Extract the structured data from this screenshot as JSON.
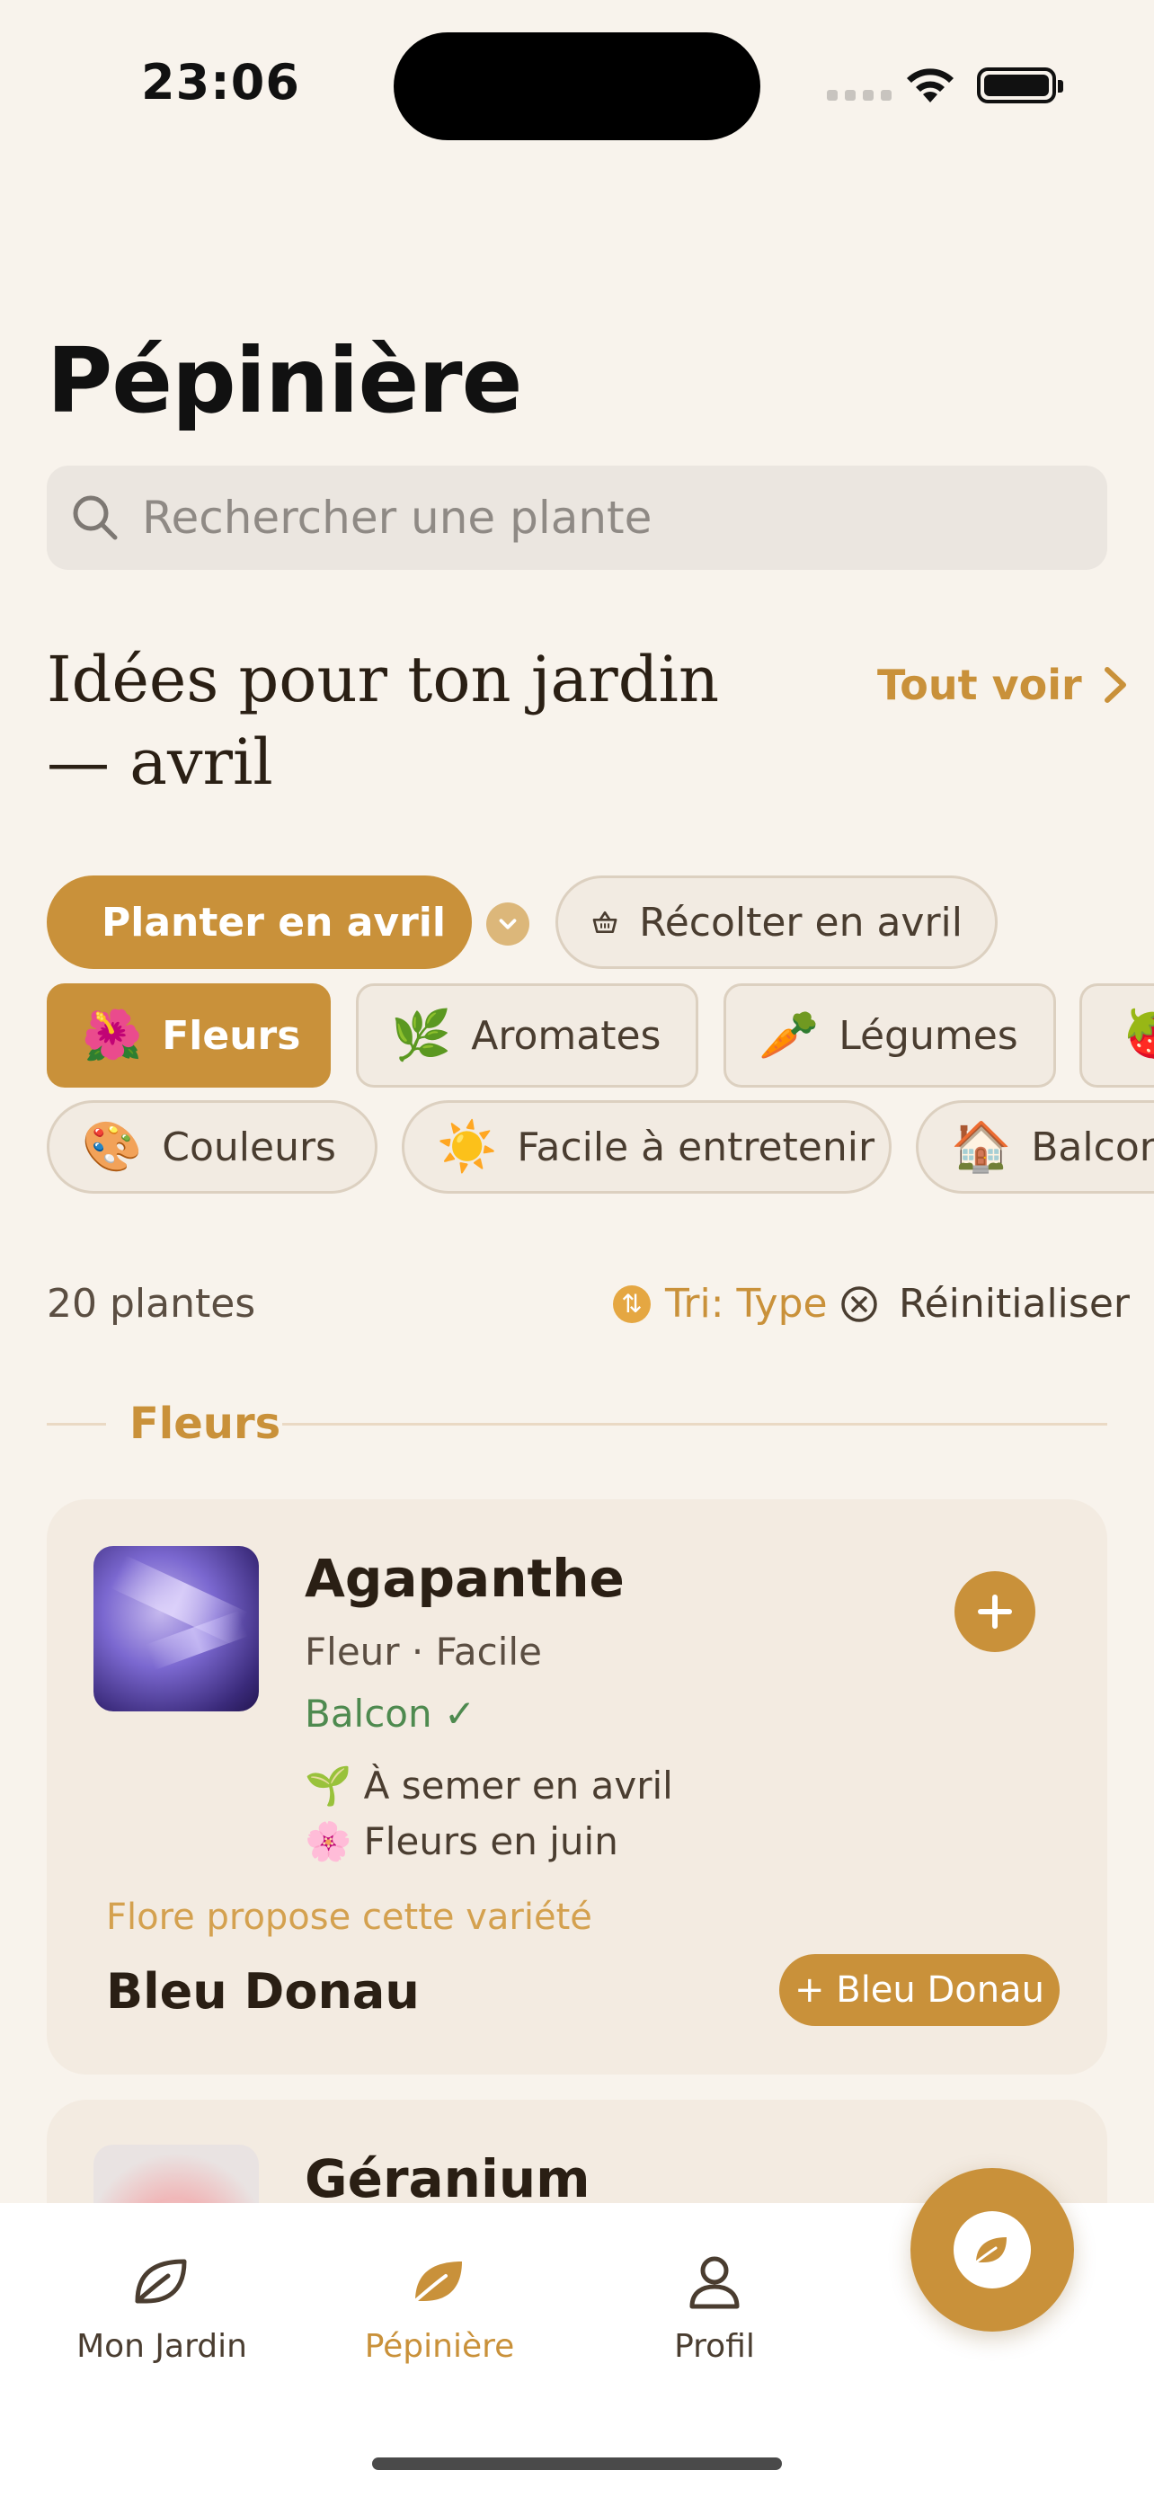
{
  "status": {
    "time": "23:06"
  },
  "page": {
    "title": "Pépinière"
  },
  "search": {
    "placeholder": "Rechercher une plante"
  },
  "ideas": {
    "title": "Idées pour ton jardin — avril",
    "see_all": "Tout voir"
  },
  "action_chips": [
    {
      "label": "Planter en avril",
      "icon": "leaf-icon",
      "active": true
    },
    {
      "label": "Récolter en avril",
      "icon": "basket-icon",
      "active": false
    }
  ],
  "category_chips": [
    {
      "emoji": "🌺",
      "label": "Fleurs",
      "active": true
    },
    {
      "emoji": "🌿",
      "label": "Aromates",
      "active": false
    },
    {
      "emoji": "🥕",
      "label": "Légumes",
      "active": false
    },
    {
      "emoji": "🍓",
      "label": "",
      "active": false
    }
  ],
  "filter_chips": [
    {
      "emoji": "🎨",
      "label": "Couleurs"
    },
    {
      "emoji": "☀️",
      "label": "Facile à entretenir"
    },
    {
      "emoji": "🏠",
      "label": "Balcon"
    }
  ],
  "results": {
    "count": "20 plantes",
    "sort": "Tri: Type",
    "reset": "Réinitialiser"
  },
  "section": {
    "label": "Fleurs"
  },
  "plants": [
    {
      "name": "Agapanthe",
      "meta": "Fleur · Facile",
      "place": "Balcon ✓",
      "sow": "🌱 À semer en avril",
      "bloom": "🌸 Fleurs en juin",
      "suggestion": "Flore propose cette variété",
      "variety": "Bleu Donau",
      "variety_button": "+ Bleu Donau"
    },
    {
      "name": "Géranium"
    }
  ],
  "tabbar": {
    "tabs": [
      {
        "label": "Mon Jardin",
        "icon": "leaf-outline-icon",
        "active": false
      },
      {
        "label": "Pépinière",
        "icon": "leaf-filled-icon",
        "active": true
      },
      {
        "label": "Profil",
        "icon": "person-icon",
        "active": false
      }
    ]
  },
  "colors": {
    "accent": "#c9913a",
    "background": "#f8f3ec",
    "card": "#f3ebe1",
    "success": "#4e8a4f"
  }
}
